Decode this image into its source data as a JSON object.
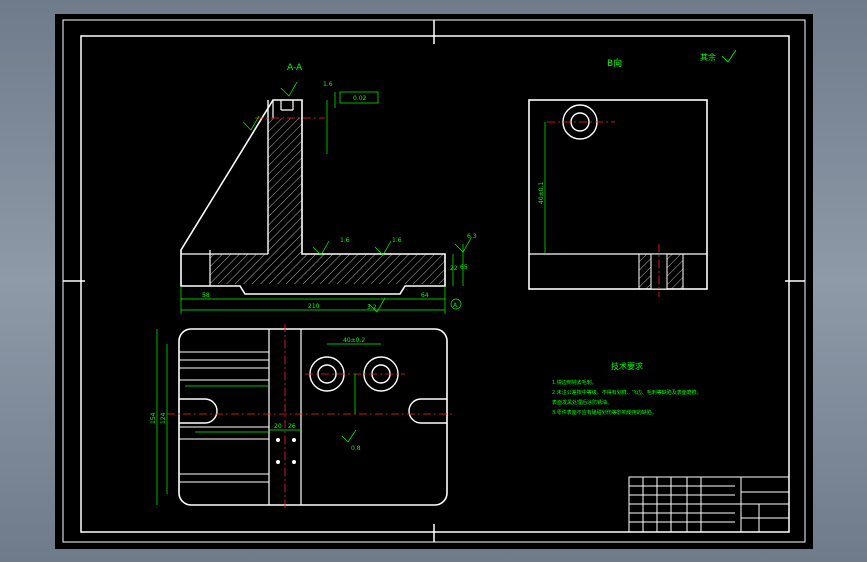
{
  "drawing": {
    "section_label": "A-A",
    "view_label": "B向",
    "general_roughness": "其余",
    "tech_req_title": "技术要求",
    "tech_req_items": [
      "1.锐边倒钝去毛刺。",
      "2.未注公差按中等级，不得有划痕、飞边、毛刺等缺陷及表面磨痕。",
      "表面发黑处理后涂防锈油。",
      "3.零件表面不应有磕碰划伤等影响使用的缺陷。"
    ],
    "dims": {
      "overall_length": "210",
      "left_len": "58",
      "right_len": "64",
      "height_total": "65",
      "flange_h": "22",
      "ra_32": "3.2",
      "ra_16": "1.6",
      "ra_63": "6.3",
      "ra_08": "0.8",
      "view_b_dim": "40±0.1",
      "plan_width": "154",
      "plan_height": "124",
      "hole_pitch": "40±0.2",
      "small_a": "20",
      "small_b": "26"
    },
    "tolerance_frame": "0.02",
    "datum": "A"
  },
  "colors": {
    "background": "#000000",
    "outline": "#ffffff",
    "dimension": "#00ff00",
    "center_line": "#ff2020",
    "hatch": "#ffffff",
    "frame": "#ffffff"
  }
}
